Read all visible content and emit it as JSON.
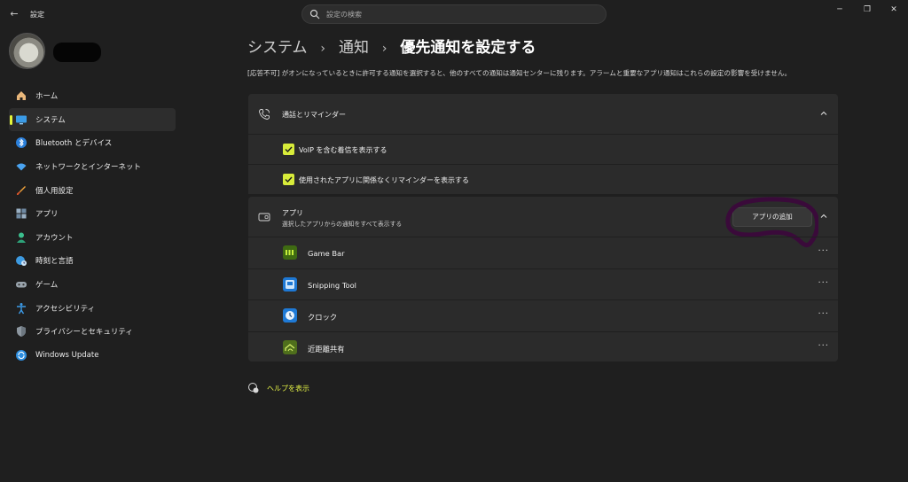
{
  "titlebar": {
    "app_title": "設定",
    "search_placeholder": "設定の検索",
    "back_glyph": "←",
    "minimize_glyph": "─",
    "maximize_glyph": "❐",
    "close_glyph": "✕"
  },
  "sidebar": {
    "items": [
      {
        "label": "ホーム",
        "icon": "home-icon"
      },
      {
        "label": "システム",
        "icon": "monitor-icon",
        "active": true
      },
      {
        "label": "Bluetooth とデバイス",
        "icon": "bluetooth-icon"
      },
      {
        "label": "ネットワークとインターネット",
        "icon": "wifi-icon"
      },
      {
        "label": "個人用設定",
        "icon": "brush-icon"
      },
      {
        "label": "アプリ",
        "icon": "apps-icon"
      },
      {
        "label": "アカウント",
        "icon": "person-icon"
      },
      {
        "label": "時刻と言語",
        "icon": "globe-clock-icon"
      },
      {
        "label": "ゲーム",
        "icon": "controller-icon"
      },
      {
        "label": "アクセシビリティ",
        "icon": "accessibility-icon"
      },
      {
        "label": "プライバシーとセキュリティ",
        "icon": "shield-icon"
      },
      {
        "label": "Windows Update",
        "icon": "update-icon"
      }
    ]
  },
  "breadcrumb": {
    "level1": "システム",
    "level2": "通知",
    "current": "優先通知を設定する",
    "separator": "›"
  },
  "description": "[応答不可] がオンになっているときに許可する通知を選択すると、他のすべての通知は通知センターに残ります。アラームと重要なアプリ通知はこれらの設定の影響を受けません。",
  "calls_section": {
    "title": "通話とリマインダー",
    "options": [
      {
        "label": "VoIP を含む着信を表示する",
        "checked": true
      },
      {
        "label": "使用されたアプリに関係なくリマインダーを表示する",
        "checked": true
      }
    ]
  },
  "apps_section": {
    "title": "アプリ",
    "subtitle": "選択したアプリからの通知をすべて表示する",
    "add_button": "アプリの追加",
    "apps": [
      {
        "label": "Game Bar",
        "icon": "game-bar-icon"
      },
      {
        "label": "Snipping Tool",
        "icon": "snipping-tool-icon"
      },
      {
        "label": "クロック",
        "icon": "clock-icon"
      },
      {
        "label": "近距離共有",
        "icon": "nearby-share-icon"
      }
    ],
    "more_glyph": "···"
  },
  "help": {
    "label": "ヘルプを表示"
  },
  "colors": {
    "accent": "#e3f53a",
    "annotation": "#3a0a3a"
  }
}
